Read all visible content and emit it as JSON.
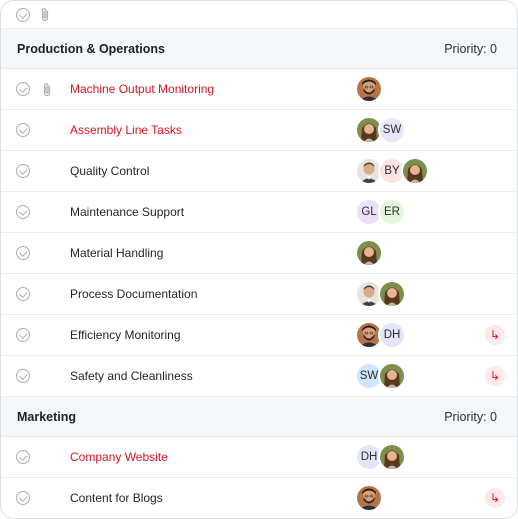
{
  "groups": [
    {
      "name": "Production & Operations",
      "priority": "Priority: 0",
      "tasks": [
        {
          "name": "Machine Output Monitoring",
          "red": true,
          "clip": true,
          "assignees": [
            {
              "type": "photo",
              "kind": "man1"
            }
          ],
          "subtask": false
        },
        {
          "name": "Assembly Line Tasks",
          "red": true,
          "clip": false,
          "assignees": [
            {
              "type": "photo",
              "kind": "woman1"
            },
            {
              "type": "initials",
              "text": "SW",
              "color": "#e6e5fb"
            }
          ],
          "subtask": false
        },
        {
          "name": "Quality Control",
          "red": false,
          "clip": false,
          "assignees": [
            {
              "type": "photo",
              "kind": "man2"
            },
            {
              "type": "initials",
              "text": "BY",
              "color": "#fde3e3"
            },
            {
              "type": "photo",
              "kind": "woman1"
            }
          ],
          "subtask": false
        },
        {
          "name": "Maintenance Support",
          "red": false,
          "clip": false,
          "assignees": [
            {
              "type": "initials",
              "text": "GL",
              "color": "#ede0fb"
            },
            {
              "type": "initials",
              "text": "ER",
              "color": "#e2f7dc"
            }
          ],
          "subtask": false
        },
        {
          "name": "Material Handling",
          "red": false,
          "clip": false,
          "assignees": [
            {
              "type": "photo",
              "kind": "woman1"
            }
          ],
          "subtask": false
        },
        {
          "name": "Process Documentation",
          "red": false,
          "clip": false,
          "assignees": [
            {
              "type": "photo",
              "kind": "man2"
            },
            {
              "type": "photo",
              "kind": "woman1"
            }
          ],
          "subtask": false
        },
        {
          "name": "Efficiency Monitoring",
          "red": false,
          "clip": false,
          "assignees": [
            {
              "type": "photo",
              "kind": "man1"
            },
            {
              "type": "initials",
              "text": "DH",
              "color": "#e4e4fb"
            }
          ],
          "subtask": true
        },
        {
          "name": "Safety and Cleanliness",
          "red": false,
          "clip": false,
          "assignees": [
            {
              "type": "initials",
              "text": "SW",
              "color": "#cfe6fb"
            },
            {
              "type": "photo",
              "kind": "woman1"
            }
          ],
          "subtask": true
        }
      ]
    },
    {
      "name": "Marketing",
      "priority": "Priority: 0",
      "tasks": [
        {
          "name": "Company Website",
          "red": true,
          "clip": false,
          "assignees": [
            {
              "type": "initials",
              "text": "DH",
              "color": "#e4e4fb"
            },
            {
              "type": "photo",
              "kind": "woman1"
            }
          ],
          "subtask": false
        },
        {
          "name": "Content for Blogs",
          "red": false,
          "clip": false,
          "assignees": [
            {
              "type": "photo",
              "kind": "man1"
            }
          ],
          "subtask": true
        }
      ]
    }
  ],
  "icons": {
    "check": "check-circle-icon",
    "attachment": "paperclip-icon",
    "subtask": "subtask-arrow-icon"
  },
  "colors": {
    "accent_red": "#e0141e",
    "group_bg": "#f5f6f8"
  }
}
